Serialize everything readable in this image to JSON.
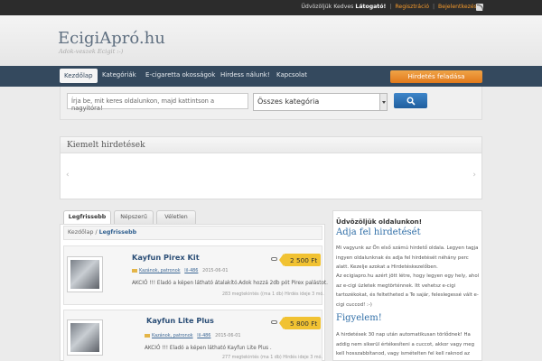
{
  "topbar": {
    "welcome": "Üdvözöljük Kedves",
    "user": "Látogató!",
    "register": "Regisztráció",
    "login": "Bejelentkezés",
    "separator": "|"
  },
  "header": {
    "title": "EcigiApró.hu",
    "tagline": "Adok-veszek Ecigit :-)"
  },
  "nav": {
    "items": [
      "Kezdőlap",
      "Kategóriák",
      "E-cigaretta okosságok",
      "Hirdess nálunk!",
      "Kapcsolat"
    ],
    "post_button": "Hirdetés feladása"
  },
  "search": {
    "placeholder": "Írja be, mit keres oldalunkon, majd kattintson a nagyítóra!",
    "category": "Összes kategória"
  },
  "featured": {
    "title": "Kiemelt hirdetések",
    "prev": "‹",
    "next": "›"
  },
  "tabs": [
    "Legfrissebb",
    "Népszerű",
    "Véletlen"
  ],
  "breadcrumb": {
    "home": "Kezdőlap",
    "sep": "/",
    "current": "Legfrissebb"
  },
  "ads": [
    {
      "title": "Kayfun Pirex Kit",
      "price": "2 500 Ft",
      "category": "Kazánok, patronok",
      "user": "lil-486",
      "date": "2015-06-01",
      "desc": "AKCIÓ !!! Eladó a képen látható átalakító.Adok hozzá 2db pót Pirex palástot.",
      "stats": "283 megtekintés ((ma 1 db) Hirdés ideje 3 mó."
    },
    {
      "title": "Kayfun Lite Plus",
      "price": "5 800 Ft",
      "category": "Kazánok, patronok",
      "user": "lil-486",
      "date": "2015-06-01",
      "desc": "AKCIÓ !!! Eladó a képen látható Kayfun Lite Plus .",
      "stats": "277 megtekintés (ma 1 db) Hirdés ideje 3 mó."
    }
  ],
  "sidebar": {
    "welcome": "Üdvözöljük oldalunkon!",
    "heading1": "Adja fel hirdetését",
    "para1": "Mi vagyunk az Ön első számú hirdető oldala. Legyen tagja ingyen oldalunknak és adja fel hirdetését néhány perc alatt. Kezelje azokat a Hirdetéskezelőben.",
    "para2": "Az ecigiapro.hu azért jött létre, hogy legyen egy hely, ahol az e-cigi üzletek megtörténnek. Itt vehetsz e-cigi tartozékokat, és feltetheted a Te sajár, feleslegessé vált e-cigi cuccod! :-)",
    "heading2": "Figyelem!",
    "para3": "A hirdetések 30 nap után automatikusan törlődnek! Ha addig nem sikerül értékesíteni a cuccot, akkor vagy meg kell hosszabbítanod, vagy ismételten fel kell raknod az oldalra!"
  },
  "colors": {
    "nav": "#34495e",
    "accent_orange": "#e8872a",
    "price_tag": "#f1c232",
    "link_blue": "#2f6ea7"
  },
  "icons": [
    "rss-icon",
    "search-icon",
    "folder-icon",
    "user-icon",
    "calendar-icon",
    "price-tag-icon",
    "chevron-down-icon"
  ]
}
